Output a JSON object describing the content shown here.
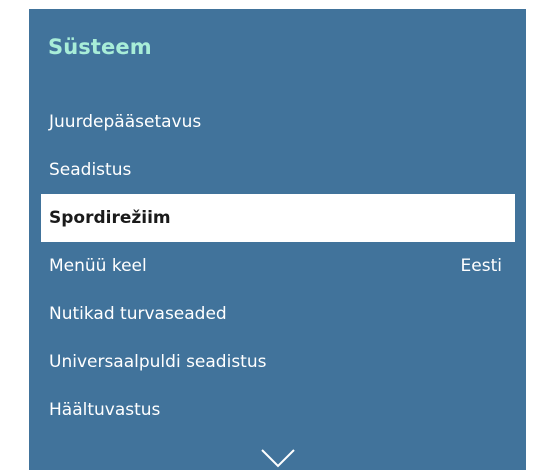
{
  "menu": {
    "title": "Süsteem",
    "items": [
      {
        "label": "Juurdepääsetavus",
        "value": ""
      },
      {
        "label": "Seadistus",
        "value": ""
      },
      {
        "label": "Spordirežiim",
        "value": ""
      },
      {
        "label": "Menüü keel",
        "value": "Eesti"
      },
      {
        "label": "Nutikad turvaseaded",
        "value": ""
      },
      {
        "label": "Universaalpuldi seadistus",
        "value": ""
      },
      {
        "label": "Häältuvastus",
        "value": ""
      }
    ],
    "selected_index": 2
  },
  "colors": {
    "panel_background": "#41739b",
    "title": "#a8edd8",
    "item_text": "#ffffff",
    "selected_background": "#ffffff",
    "selected_text": "#1a1a1a"
  },
  "icons": {
    "scroll_down": "chevron-down-icon"
  }
}
